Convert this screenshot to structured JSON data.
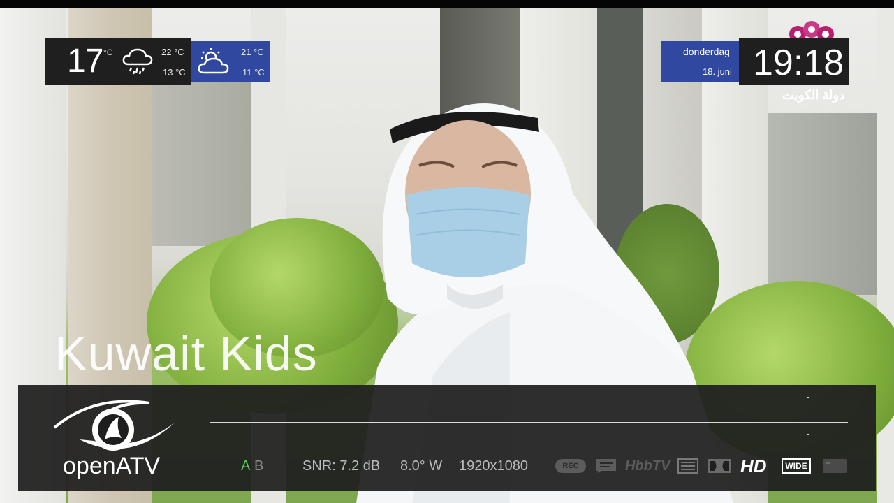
{
  "weather": {
    "current_temp": "17",
    "current_unit": "°C",
    "today_high": "22 °C",
    "today_low": "13 °C",
    "today_icon": "rain-cloud-icon",
    "tomorrow_high": "21 °C",
    "tomorrow_low": "11 °C",
    "tomorrow_icon": "partly-sunny-icon"
  },
  "datetime": {
    "weekday": "donderdag",
    "date": "18. juni",
    "time": "19:18"
  },
  "broadcaster_logo_text": "دولة الكويت",
  "channel": {
    "name": "Kuwait Kids"
  },
  "infobar": {
    "brand": "openATV",
    "event_now_dash": "-",
    "event_next_dash": "-",
    "tuner_a": "A",
    "tuner_b": "B",
    "snr": "SNR: 7.2 dB",
    "orbital": "8.0° W",
    "resolution": "1920x1080",
    "icons": [
      "rec-icon",
      "subtitle-icon",
      "hbbtv-icon",
      "teletext-icon",
      "dolby-icon",
      "hd-icon",
      "wide-icon",
      "crypt-icon"
    ],
    "hbbtv_label": "HbbTV",
    "hd_label": "HD",
    "wide_label": "WIDE",
    "rec_label": "REC"
  },
  "colors": {
    "accent_blue": "#3048a0",
    "panel_dark": "#1f1f1f",
    "tuner_active": "#55d155"
  }
}
